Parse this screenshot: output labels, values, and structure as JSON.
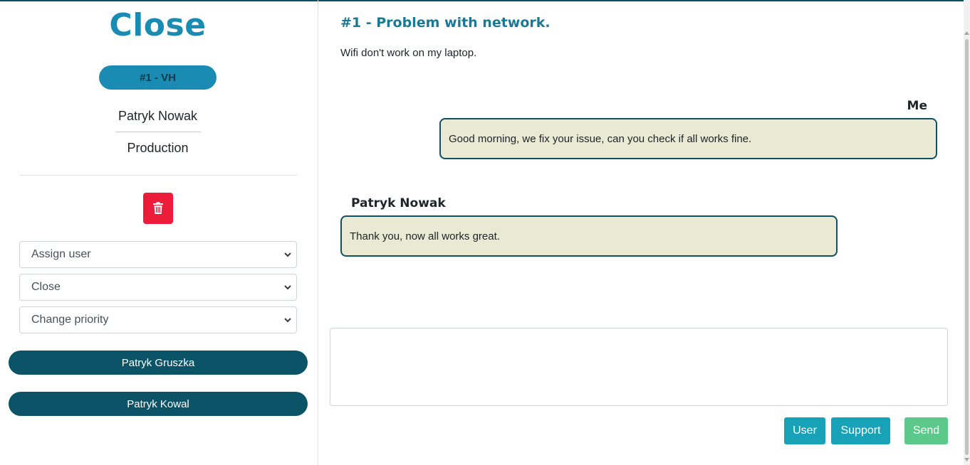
{
  "ticket": {
    "status_title": "Close",
    "ticket_label": "#1 - VH",
    "user_name": "Patryk Nowak",
    "department": "Production"
  },
  "actions": {
    "delete_icon": "trash-icon",
    "assign_user": "Assign user",
    "status_select": "Close",
    "priority_select": "Change priority"
  },
  "agents": [
    {
      "name": "Patryk Gruszka"
    },
    {
      "name": "Patryk Kowal"
    }
  ],
  "issue": {
    "title": "#1 - Problem with network.",
    "description": "Wifi don't work on my laptop."
  },
  "messages": [
    {
      "author": "Me",
      "text": "Good morning, we fix your issue, can you check if all works fine."
    },
    {
      "author": "Patryk Nowak",
      "text": "Thank you, now all works great."
    }
  ],
  "reply": {
    "value": "",
    "user_button": "User",
    "support_button": "Support",
    "send_button": "Send"
  },
  "colors": {
    "accent": "#1a8cb4",
    "agent_button": "#0b5467",
    "delete_button": "#ed1c3a",
    "bubble_bg": "#e9e9d4",
    "send_button": "#5cc98b",
    "info_button": "#17a2b8"
  }
}
